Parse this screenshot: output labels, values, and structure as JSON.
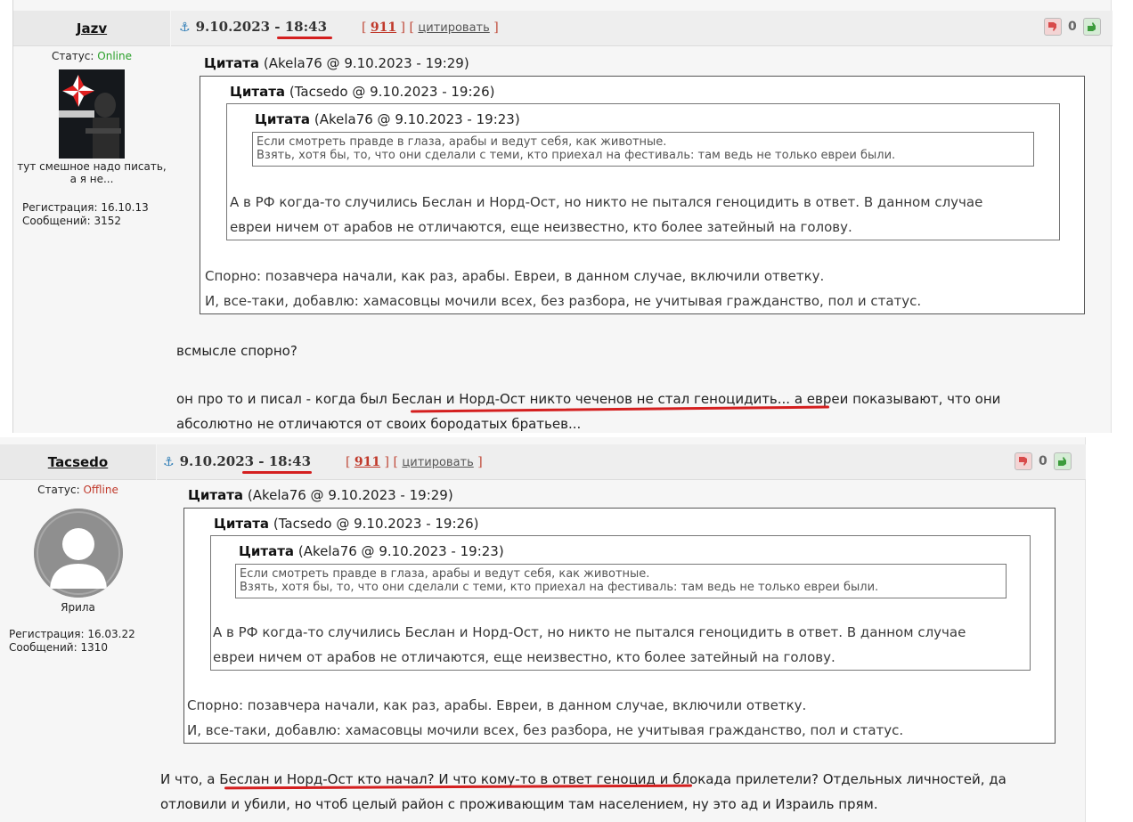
{
  "posts": [
    {
      "username": "Jazv",
      "status_label": "Статус:",
      "status": "Online",
      "user_text_line1": "тут смешное надо писать,",
      "user_text_line2": "а я не...",
      "registration": "Регистрация: 16.10.13",
      "messages": "Сообщений: 3152",
      "date": "9.10.2023 - 18:43",
      "post_link": "911",
      "cite_link": "цитировать",
      "rating": "0",
      "quote_author": "Цитата",
      "quote1_meta": "(Akela76 @ 9.10.2023 - 19:29)",
      "quote2_meta": "(Tacsedo @ 9.10.2023 - 19:26)",
      "quote3_meta": "(Akela76 @ 9.10.2023 - 19:23)",
      "q3_line1": "Если смотреть правде в глаза, арабы и ведут себя, как животные.",
      "q3_line2": "Взять, хотя бы, то, что они сделали с теми, кто приехал на фестиваль: там ведь не только евреи были.",
      "q2_line1": "А в РФ когда-то случились Беслан и Норд-Ост, но никто не пытался геноцидить в ответ. В данном случае",
      "q2_line2": "евреи ничем от арабов не отличаются, еще неизвестно, кто более затейный на голову.",
      "q1_line1": "Спорно: позавчера начали, как раз, арабы. Евреи, в данном случае, включили ответку.",
      "q1_line2": "И, все-таки, добавлю: хамасовцы мочили всех, без разбора, не учитывая гражданство, пол и статус.",
      "body_line1": "всмысле спорно?",
      "body_line2": "он про то и писал - когда был Беслан и Норд-Ост никто чеченов не стал геноцидить... а евреи показывают, что они",
      "body_line3": "абсолютно не отличаются от своих бородатых братьев..."
    },
    {
      "username": "Tacsedo",
      "status_label": "Статус:",
      "status": "Offline",
      "user_text_line1": "Ярила",
      "registration": "Регистрация: 16.03.22",
      "messages": "Сообщений: 1310",
      "date": "9.10.2023 - 18:43",
      "post_link": "911",
      "cite_link": "цитировать",
      "rating": "0",
      "quote_author": "Цитата",
      "quote1_meta": "(Akela76 @ 9.10.2023 - 19:29)",
      "quote2_meta": "(Tacsedo @ 9.10.2023 - 19:26)",
      "quote3_meta": "(Akela76 @ 9.10.2023 - 19:23)",
      "q3_line1": "Если смотреть правде в глаза, арабы и ведут себя, как животные.",
      "q3_line2": "Взять, хотя бы, то, что они сделали с теми, кто приехал на фестиваль: там ведь не только евреи были.",
      "q2_line1": "А в РФ когда-то случились Беслан и Норд-Ост, но никто не пытался геноцидить в ответ. В данном случае",
      "q2_line2": "евреи ничем от арабов не отличаются, еще неизвестно, кто более затейный на голову.",
      "q1_line1": "Спорно: позавчера начали, как раз, арабы. Евреи, в данном случае, включили ответку.",
      "q1_line2": "И, все-таки, добавлю: хамасовцы мочили всех, без разбора, не учитывая гражданство, пол и статус.",
      "body_line1": "И что, а Беслан и Норд-Ост кто начал? И что кому-то в ответ геноцид и блокада прилетели? Отдельных личностей, да",
      "body_line2": "отловили и убили, но чтоб целый район с проживающим там населением, ну это ад и Израиль прям."
    }
  ],
  "colors": {
    "online": "#2aa02a",
    "offline": "#c0392b",
    "link": "#c0392b",
    "anchor": "#2f7db6",
    "annotation": "#d41f1f"
  },
  "icons": [
    "anchor-icon",
    "thumb-down-icon",
    "thumb-up-icon",
    "umbrella-logo-icon",
    "user-silhouette-icon"
  ]
}
